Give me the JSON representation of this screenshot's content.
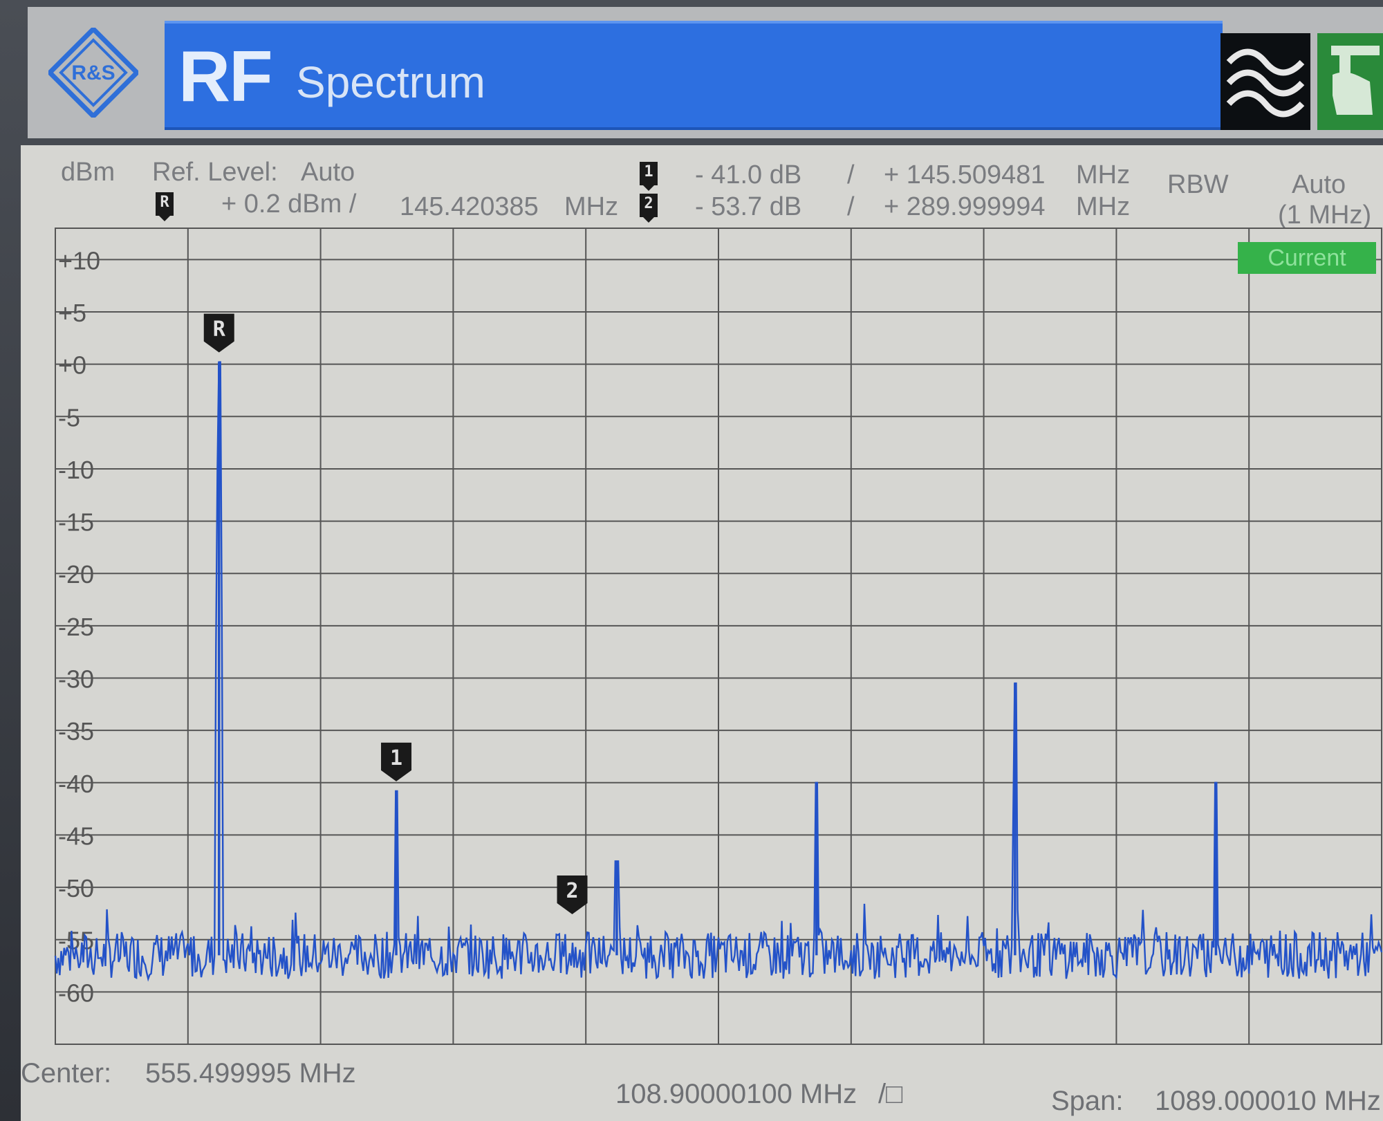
{
  "header": {
    "logo_text": "R&S",
    "title_main": "RF",
    "title_sub": "Spectrum"
  },
  "info": {
    "unit": "dBm",
    "ref_level_label": "Ref. Level:",
    "ref_level_value": "Auto",
    "ref_marker": {
      "badge": "R",
      "level": "+ 0.2  dBm  /",
      "freq": "145.420385",
      "freq_unit": "MHz"
    },
    "marker1": {
      "badge": "1",
      "delta": "- 41.0  dB",
      "sep": "/",
      "freq": "+ 145.509481",
      "freq_unit": "MHz"
    },
    "marker2": {
      "badge": "2",
      "delta": "- 53.7  dB",
      "sep": "/",
      "freq": "+ 289.999994",
      "freq_unit": "MHz"
    },
    "rbw_label": "RBW",
    "rbw_value": "Auto",
    "rbw_detail": "(1 MHz)"
  },
  "current_label": "Current",
  "footer": {
    "center_label": "Center:",
    "center_value": "555.499995  MHz",
    "div_value": "108.90000100 MHz",
    "div_unit": "/□",
    "span_label": "Span:",
    "span_value": "1089.000010  MHz"
  },
  "colors": {
    "trace": "#2352c8",
    "grid": "#555555",
    "background": "#d6d6d2",
    "title_bar": "#2d6fe0",
    "current_badge": "#35b24a"
  },
  "chart_data": {
    "type": "line",
    "title": "",
    "xlabel": "",
    "ylabel": "dBm",
    "xlim": [
      11.0,
      1100.0
    ],
    "ylim": [
      -65,
      13
    ],
    "y_ticks": [
      "+10",
      "+5",
      "+0",
      "-5",
      "-10",
      "-15",
      "-20",
      "-25",
      "-30",
      "-35",
      "-40",
      "-45",
      "-50",
      "-55",
      "-60"
    ],
    "y_tick_values": [
      10,
      5,
      0,
      -5,
      -10,
      -15,
      -20,
      -25,
      -30,
      -35,
      -40,
      -45,
      -50,
      -55,
      -60
    ],
    "x_divisions": 10,
    "grid": true,
    "noise_floor": -56.5,
    "series": [
      {
        "peaks": [
          {
            "x": 145.42,
            "y": 0.2
          },
          {
            "x": 290.93,
            "y": -40.8
          },
          {
            "x": 472.0,
            "y": -47.5
          },
          {
            "x": 636.0,
            "y": -40.0
          },
          {
            "x": 799.0,
            "y": -30.5
          },
          {
            "x": 964.0,
            "y": -40.0
          }
        ]
      }
    ],
    "markers": [
      {
        "label": "R",
        "x": 145.42,
        "y": 0.2
      },
      {
        "label": "1",
        "x": 290.93,
        "y": -40.8
      },
      {
        "label": "2",
        "x": 435.42,
        "y": -53.5
      }
    ]
  }
}
